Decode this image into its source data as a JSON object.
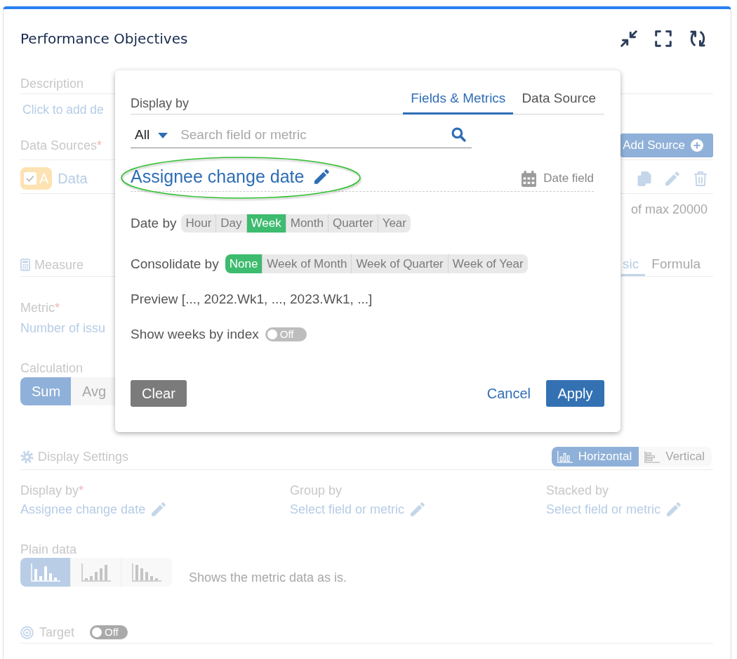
{
  "widget": {
    "title": "Performance Objectives"
  },
  "background": {
    "description": {
      "label": "Description",
      "link": "Click to add de"
    },
    "data_sources": {
      "label": "Data Sources",
      "required_mark": "*",
      "add_button": "Add Source",
      "sources": [
        {
          "badge": "A",
          "checked": true,
          "name": "Data"
        }
      ],
      "limit_text": "of max 20000"
    },
    "measure": {
      "label": "Measure",
      "tabs": [
        {
          "label": "sic",
          "selected": true
        },
        {
          "label": "Formula",
          "selected": false
        }
      ],
      "metric": {
        "label": "Metric",
        "required_mark": "*",
        "value": "Number of issu"
      },
      "calculation": {
        "label": "Calculation",
        "options": [
          {
            "label": "Sum",
            "selected": true
          },
          {
            "label": "Avg",
            "selected": false
          }
        ]
      }
    },
    "display_settings": {
      "label": "Display Settings",
      "orientations": [
        {
          "label": "Horizontal",
          "kind": "columns",
          "selected": true
        },
        {
          "label": "Vertical",
          "kind": "bars",
          "selected": false
        }
      ],
      "fields": [
        {
          "label": "Display by",
          "required_mark": "*",
          "value": "Assignee change date"
        },
        {
          "label": "Group by",
          "value": "Select field or metric"
        },
        {
          "label": "Stacked by",
          "value": "Select field or metric"
        }
      ],
      "plain_data": {
        "label": "Plain data",
        "chart_types": [
          {
            "kind": "plain",
            "selected": true
          },
          {
            "kind": "ascending",
            "selected": false
          },
          {
            "kind": "descending",
            "selected": false
          }
        ],
        "note": "Shows the metric data as is."
      }
    },
    "target": {
      "label": "Target",
      "on": false,
      "state_text": "Off"
    }
  },
  "popup": {
    "label": "Display by",
    "tabs": [
      {
        "label": "Fields & Metrics",
        "selected": true
      },
      {
        "label": "Data Source",
        "selected": false
      }
    ],
    "search": {
      "filter": "All",
      "placeholder": "Search field or metric"
    },
    "field": {
      "name": "Assignee change date",
      "type_label": "Date field",
      "highlighted": true
    },
    "date_by": {
      "label": "Date by",
      "options": [
        {
          "label": "Hour",
          "selected": false
        },
        {
          "label": "Day",
          "selected": false
        },
        {
          "label": "Week",
          "selected": true
        },
        {
          "label": "Month",
          "selected": false
        },
        {
          "label": "Quarter",
          "selected": false
        },
        {
          "label": "Year",
          "selected": false
        }
      ]
    },
    "consolidate_by": {
      "label": "Consolidate by",
      "options": [
        {
          "label": "None",
          "selected": true
        },
        {
          "label": "Week of Month",
          "selected": false
        },
        {
          "label": "Week of Quarter",
          "selected": false
        },
        {
          "label": "Week of Year",
          "selected": false
        }
      ]
    },
    "preview": "Preview [..., 2022.Wk1, ..., 2023.Wk1, ...]",
    "show_weeks_by_index": {
      "label": "Show weeks by index",
      "on": false,
      "state_text": "Off"
    },
    "buttons": [
      {
        "label": "Clear",
        "kind": "secondary"
      },
      {
        "label": "Cancel",
        "kind": "link"
      },
      {
        "label": "Apply",
        "kind": "primary"
      }
    ]
  }
}
